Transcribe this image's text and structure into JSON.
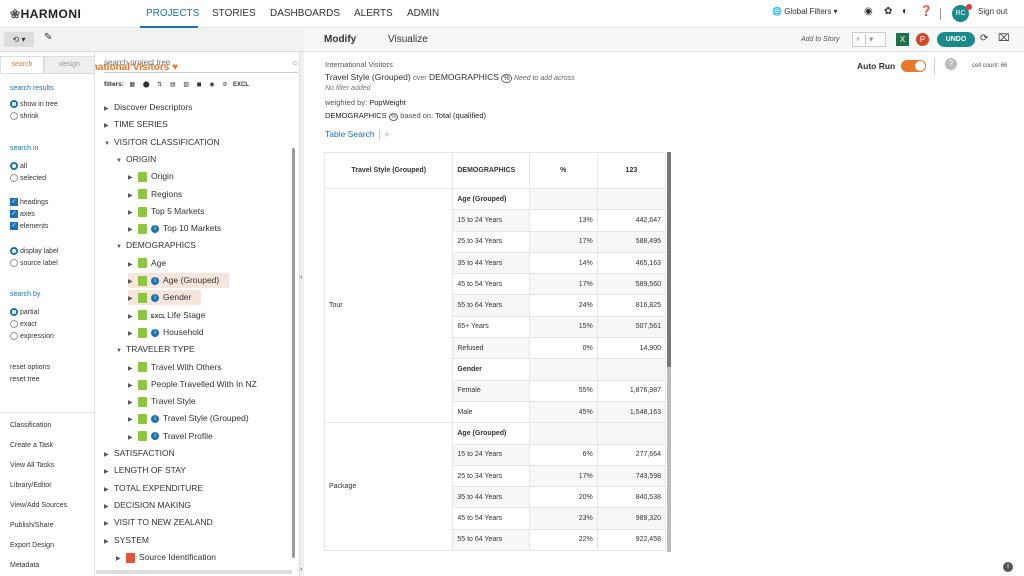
{
  "nav": {
    "logo": "HARMONI",
    "items": [
      "PROJECTS",
      "STORIES",
      "DASHBOARDS",
      "ALERTS",
      "ADMIN"
    ],
    "global_filters": "Global Filters",
    "avatar": "RC",
    "sign_out": "Sign out"
  },
  "toolbar": {
    "project_title": "International Visitors",
    "tabs": [
      "Modify",
      "Visualize"
    ],
    "add_to_story": "Add to Story",
    "undo": "UNDO"
  },
  "left": {
    "tabs": [
      "search",
      "design"
    ],
    "search_results": "search results",
    "show_in_tree": "show in tree",
    "shrink": "shrink",
    "search_in": "search in",
    "all": "all",
    "selected": "selected",
    "headings": "headings",
    "axes": "axes",
    "elements": "elements",
    "display_label": "display label",
    "source_label": "source label",
    "search_by": "search by",
    "partial": "partial",
    "exact": "exact",
    "expression": "expression",
    "reset_options": "reset options",
    "reset_tree": "reset tree",
    "links": [
      "Classification",
      "Create a Task",
      "View All Tasks",
      "Library/Editor",
      "View/Add Sources",
      "Publish/Share",
      "Export Design",
      "Metadata"
    ]
  },
  "tree": {
    "placeholder": "search project tree",
    "filters": "filters:",
    "excl": "EXCL",
    "rows": [
      {
        "label": "Discover Descriptors",
        "indent": 0,
        "arrow": "▶",
        "icon": ""
      },
      {
        "label": "TIME SERIES",
        "indent": 0,
        "arrow": "▶",
        "icon": ""
      },
      {
        "label": "VISITOR CLASSIFICATION",
        "indent": 0,
        "arrow": "▼",
        "icon": ""
      },
      {
        "label": "ORIGIN",
        "indent": 1,
        "arrow": "▼",
        "icon": ""
      },
      {
        "label": "Origin",
        "indent": 2,
        "arrow": "▶",
        "icon": "g"
      },
      {
        "label": "Regions",
        "indent": 2,
        "arrow": "▶",
        "icon": "g"
      },
      {
        "label": "Top 5 Markets",
        "indent": 2,
        "arrow": "▶",
        "icon": "g"
      },
      {
        "label": "Top 10 Markets",
        "indent": 2,
        "arrow": "▶",
        "icon": "gi"
      },
      {
        "label": "DEMOGRAPHICS",
        "indent": 1,
        "arrow": "▼",
        "icon": ""
      },
      {
        "label": "Age",
        "indent": 2,
        "arrow": "▶",
        "icon": "g"
      },
      {
        "label": "Age (Grouped)",
        "indent": 2,
        "arrow": "▶",
        "icon": "gi",
        "hl": true
      },
      {
        "label": "Gender",
        "indent": 2,
        "arrow": "▶",
        "icon": "gi",
        "hl": true
      },
      {
        "label": "Life Stage",
        "indent": 2,
        "arrow": "▶",
        "icon": "gx"
      },
      {
        "label": "Household",
        "indent": 2,
        "arrow": "▶",
        "icon": "gi"
      },
      {
        "label": "TRAVELER TYPE",
        "indent": 1,
        "arrow": "▼",
        "icon": ""
      },
      {
        "label": "Travel With Others",
        "indent": 2,
        "arrow": "▶",
        "icon": "g"
      },
      {
        "label": "People Travelled With In NZ",
        "indent": 2,
        "arrow": "▶",
        "icon": "g"
      },
      {
        "label": "Travel Style",
        "indent": 2,
        "arrow": "▶",
        "icon": "g"
      },
      {
        "label": "Travel Style (Grouped)",
        "indent": 2,
        "arrow": "▶",
        "icon": "gi"
      },
      {
        "label": "Travel Profile",
        "indent": 2,
        "arrow": "▶",
        "icon": "gi"
      },
      {
        "label": "SATISFACTION",
        "indent": 0,
        "arrow": "▶",
        "icon": ""
      },
      {
        "label": "LENGTH OF STAY",
        "indent": 0,
        "arrow": "▶",
        "icon": ""
      },
      {
        "label": "TOTAL EXPENDITURE",
        "indent": 0,
        "arrow": "▶",
        "icon": ""
      },
      {
        "label": "DECISION MAKING",
        "indent": 0,
        "arrow": "▶",
        "icon": ""
      },
      {
        "label": "VISIT TO NEW ZEALAND",
        "indent": 0,
        "arrow": "▶",
        "icon": ""
      },
      {
        "label": "SYSTEM",
        "indent": 0,
        "arrow": "▶",
        "icon": ""
      },
      {
        "label": "Source Identification",
        "indent": 1,
        "arrow": "▶",
        "icon": "r"
      }
    ]
  },
  "report": {
    "project": "International Visitors",
    "row_dim": "Travel Style (Grouped)",
    "over": "over",
    "col_dim": "DEMOGRAPHICS",
    "need": "Need to add across",
    "no_filter": "No filter added",
    "weighted_by_label": "weighted by:",
    "weighted_by": "PopWeight",
    "demo": "DEMOGRAPHICS",
    "based_on": "based on:",
    "based_val": "Total (qualified)",
    "table_search": "Table Search",
    "auto_run": "Auto Run",
    "cell_count": "cell count: 66"
  },
  "table": {
    "headers": [
      "Travel Style (Grouped)",
      "DEMOGRAPHICS",
      "%",
      "123"
    ],
    "groups": [
      {
        "name": "Tour",
        "rows": [
          {
            "label": "Age (Grouped)",
            "grp": true
          },
          {
            "label": "15 to 24 Years",
            "pct": "13%",
            "val": "442,647"
          },
          {
            "label": "25 to 34 Years",
            "pct": "17%",
            "val": "588,495"
          },
          {
            "label": "35 to 44 Years",
            "pct": "14%",
            "val": "465,163"
          },
          {
            "label": "45 to 54 Years",
            "pct": "17%",
            "val": "589,560"
          },
          {
            "label": "55 to 64 Years",
            "pct": "24%",
            "val": "816,825"
          },
          {
            "label": "65+ Years",
            "pct": "15%",
            "val": "507,561"
          },
          {
            "label": "Refused",
            "pct": "0%",
            "val": "14,900"
          },
          {
            "label": "Gender",
            "grp": true
          },
          {
            "label": "Female",
            "pct": "55%",
            "val": "1,876,987"
          },
          {
            "label": "Male",
            "pct": "45%",
            "val": "1,548,163"
          }
        ]
      },
      {
        "name": "Package",
        "rows": [
          {
            "label": "Age (Grouped)",
            "grp": true
          },
          {
            "label": "15 to 24 Years",
            "pct": "6%",
            "val": "277,664"
          },
          {
            "label": "25 to 34 Years",
            "pct": "17%",
            "val": "743,598"
          },
          {
            "label": "35 to 44 Years",
            "pct": "20%",
            "val": "840,538"
          },
          {
            "label": "45 to 54 Years",
            "pct": "23%",
            "val": "989,320"
          },
          {
            "label": "55 to 64 Years",
            "pct": "22%",
            "val": "922,458"
          }
        ]
      }
    ]
  }
}
